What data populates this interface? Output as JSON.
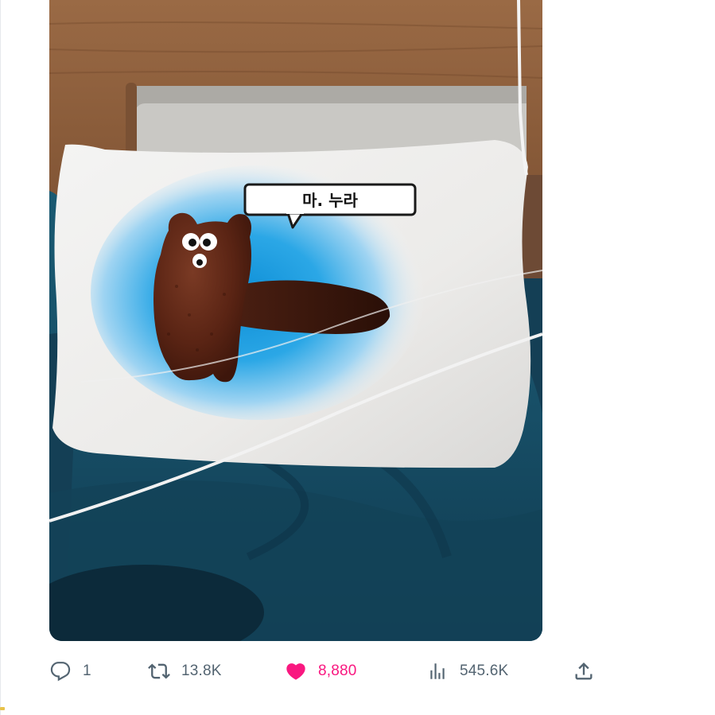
{
  "tweet": {
    "media": {
      "speech_bubble_text": "마. 누라"
    },
    "actions": {
      "reply": {
        "icon": "reply-icon",
        "count": "1"
      },
      "retweet": {
        "icon": "retweet-icon",
        "count": "13.8K"
      },
      "like": {
        "icon": "heart-icon",
        "count": "8,880",
        "liked": true,
        "color": "#f91880"
      },
      "views": {
        "icon": "views-icon",
        "count": "545.6K"
      },
      "share": {
        "icon": "share-icon"
      }
    },
    "colors": {
      "muted": "#536471",
      "like_accent": "#f91880"
    }
  }
}
